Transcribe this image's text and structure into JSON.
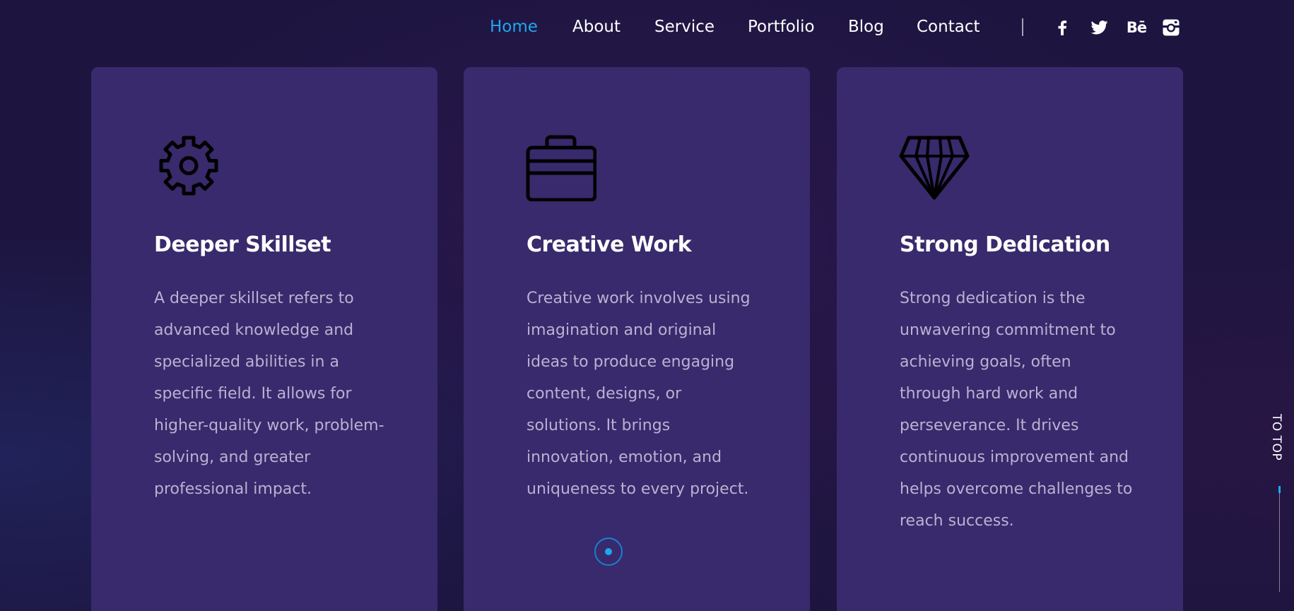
{
  "nav": {
    "links": [
      {
        "label": "Home",
        "active": true
      },
      {
        "label": "About",
        "active": false
      },
      {
        "label": "Service",
        "active": false
      },
      {
        "label": "Portfolio",
        "active": false
      },
      {
        "label": "Blog",
        "active": false
      },
      {
        "label": "Contact",
        "active": false
      }
    ],
    "social": [
      {
        "icon": "facebook-icon"
      },
      {
        "icon": "twitter-icon"
      },
      {
        "icon": "behance-icon",
        "text": "Bē"
      },
      {
        "icon": "instagram-icon"
      }
    ]
  },
  "cards": [
    {
      "icon": "gear-icon",
      "title": "Deeper Skillset",
      "text": "A deeper skillset refers to advanced knowledge and specialized abilities in a specific field. It allows for higher-quality work, problem-solving, and greater professional impact."
    },
    {
      "icon": "briefcase-icon",
      "title": "Creative Work",
      "text": "Creative work involves using imagination and original ideas to produce engaging content, designs, or solutions. It brings innovation, emotion, and uniqueness to every project."
    },
    {
      "icon": "diamond-icon",
      "title": "Strong Dedication",
      "text": "Strong dedication is the unwavering commitment to achieving goals, often through hard work and perseverance. It drives continuous improvement and helps overcome challenges to reach success."
    }
  ],
  "to_top": {
    "label": "TO TOP"
  },
  "colors": {
    "background": "#1d1540",
    "card": "#382a6c",
    "accent": "#1ea7ef",
    "body_text": "#b9b2d2"
  }
}
